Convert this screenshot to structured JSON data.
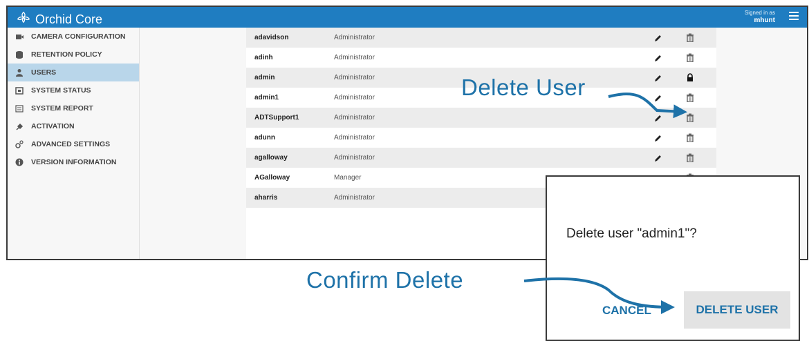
{
  "app": {
    "brand": "Orchid Core",
    "signed_in_label": "Signed in as",
    "signed_in_user": "mhunt"
  },
  "sidebar": {
    "items": [
      {
        "label": "CAMERA CONFIGURATION",
        "icon": "camera-icon"
      },
      {
        "label": "RETENTION POLICY",
        "icon": "database-icon"
      },
      {
        "label": "USERS",
        "icon": "user-icon",
        "active": true
      },
      {
        "label": "SYSTEM STATUS",
        "icon": "status-icon"
      },
      {
        "label": "SYSTEM REPORT",
        "icon": "report-icon"
      },
      {
        "label": "ACTIVATION",
        "icon": "plug-icon"
      },
      {
        "label": "ADVANCED SETTINGS",
        "icon": "gears-icon"
      },
      {
        "label": "VERSION INFORMATION",
        "icon": "info-icon"
      }
    ]
  },
  "users": [
    {
      "username": "adavidson",
      "role": "Administrator",
      "locked": false
    },
    {
      "username": "adinh",
      "role": "Administrator",
      "locked": false
    },
    {
      "username": "admin",
      "role": "Administrator",
      "locked": true
    },
    {
      "username": "admin1",
      "role": "Administrator",
      "locked": false
    },
    {
      "username": "ADTSupport1",
      "role": "Administrator",
      "locked": false
    },
    {
      "username": "adunn",
      "role": "Administrator",
      "locked": false
    },
    {
      "username": "agalloway",
      "role": "Administrator",
      "locked": false
    },
    {
      "username": "AGalloway",
      "role": "Manager",
      "locked": false
    },
    {
      "username": "aharris",
      "role": "Administrator",
      "locked": false
    }
  ],
  "annotations": {
    "delete_user": "Delete User",
    "confirm_delete": "Confirm Delete"
  },
  "dialog": {
    "message": "Delete user \"admin1\"?",
    "cancel_label": "CANCEL",
    "delete_label": "DELETE USER"
  },
  "colors": {
    "topbar": "#1f7dc1",
    "accent": "#1e72a8",
    "active_item": "#b9d6ea"
  }
}
